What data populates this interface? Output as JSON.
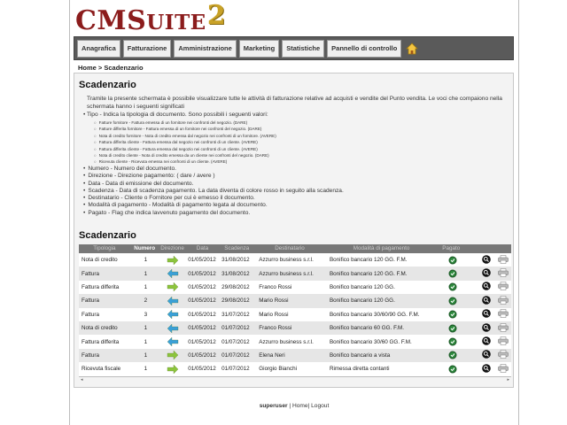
{
  "logo": {
    "text_big": "CMS",
    "text_small": "UITE",
    "superscript": "2"
  },
  "nav": [
    {
      "label": "Anagrafica"
    },
    {
      "label": "Fatturazione"
    },
    {
      "label": "Amministrazione"
    },
    {
      "label": "Marketing"
    },
    {
      "label": "Statistiche"
    },
    {
      "label": "Pannello di controllo"
    }
  ],
  "breadcrumb": "Home >  Scadenzario",
  "heading": "Scadenzario",
  "intro": "Tramite la presente schermata è possibile visualizzare tutte le attività di fatturazione relative ad acquisti e vendite del Punto vendita. Le voci che compaiono nella schermata hanno i seguenti significati",
  "tipo_item": "Tipo - Indica la tipologia di documento. Sono possibili i seguenti valori:",
  "tipo_values": [
    "Fatture fornitore - Fattura emessa di un fornitore nei confronti del negozio. (DARE)",
    "Fatture differita fornitore - Fattura emessa di un fornitore nei confronti del negozio. (DARE)",
    "Nota di credito fornitore - Nota di credito emessa dal negozio nei confronti di un fornitore. (AVERE)",
    "Fattura differita cliente - Fattura emessa dal negozio nei confronti di un cliente. (AVERE)",
    "Fattura differita cliente - Fattura emessa dal negozio nei confronti di un cliente. (AVERE)",
    "Nota di credito cliente - Nota di credito emessa da un cliente nei confronti del negozio. (DARE)",
    "Ricevuta cliente - Ricevuta emessa nei confronti di un cliente. (AVERE)"
  ],
  "list_items": [
    "Numero - Numero del documento.",
    "Direzione - Direzione pagamento: ( dare / avere )",
    "Data - Data di emissione del documento.",
    "Scadenza - Data di scadenza pagamento. La data diventa di colore rosso in seguito alla scadenza.",
    "Destinatario - Cliente o Fornitore per cui è emesso il documento.",
    "Modalità di pagamento - Modalità di pagamento legata al documento.",
    "Pagato - Flag che indica lavvenuto pagamento del documento."
  ],
  "table_heading": "Scadenzario",
  "columns": [
    "Tipologia",
    "Numero",
    "Direzione",
    "Data",
    "Scadenza",
    "Destinatario",
    "Modalità di pagamento",
    "Pagato"
  ],
  "rows": [
    {
      "tipo": "Nota di credito",
      "num": "1",
      "dir": "right",
      "data": "01/05/2012",
      "scad": "31/08/2012",
      "dest": "Azzurro business s.r.l.",
      "mod": "Bonifico bancario 120 GG. F.M."
    },
    {
      "tipo": "Fattura",
      "num": "1",
      "dir": "left",
      "data": "01/05/2012",
      "scad": "31/08/2012",
      "dest": "Azzurro business s.r.l.",
      "mod": "Bonifico bancario 120 GG. F.M."
    },
    {
      "tipo": "Fattura differita",
      "num": "1",
      "dir": "right",
      "data": "01/05/2012",
      "scad": "29/08/2012",
      "dest": "Franco Rossi",
      "mod": "Bonifico bancario 120 GG."
    },
    {
      "tipo": "Fattura",
      "num": "2",
      "dir": "left",
      "data": "01/05/2012",
      "scad": "29/08/2012",
      "dest": "Mario Rossi",
      "mod": "Bonifico bancario 120 GG."
    },
    {
      "tipo": "Fattura",
      "num": "3",
      "dir": "left",
      "data": "01/05/2012",
      "scad": "31/07/2012",
      "dest": "Mario Rossi",
      "mod": "Bonifico bancario 30/60/90 GG. F.M."
    },
    {
      "tipo": "Nota di credito",
      "num": "1",
      "dir": "left",
      "data": "01/05/2012",
      "scad": "01/07/2012",
      "dest": "Franco Rossi",
      "mod": "Bonifico bancario 60 GG. F.M."
    },
    {
      "tipo": "Fattura differita",
      "num": "1",
      "dir": "left",
      "data": "01/05/2012",
      "scad": "01/07/2012",
      "dest": "Azzurro business s.r.l.",
      "mod": "Bonifico bancario 30/60 GG. F.M."
    },
    {
      "tipo": "Fattura",
      "num": "1",
      "dir": "right",
      "data": "01/05/2012",
      "scad": "01/07/2012",
      "dest": "Elena Neri",
      "mod": "Bonifico bancario a vista"
    },
    {
      "tipo": "Ricevuta fiscale",
      "num": "1",
      "dir": "right",
      "data": "01/05/2012",
      "scad": "01/07/2012",
      "dest": "Giorgio Bianchi",
      "mod": "Rimessa diretta contanti"
    }
  ],
  "footer": {
    "user": "superuser",
    "home": "Home",
    "logout": "Logout"
  },
  "colors": {
    "logo_red": "#8b1c1c",
    "logo_gold": "#c9a227",
    "nav_bg": "#5a5a5a",
    "arrow_right": "#8cc43c",
    "arrow_left": "#3aa0d8",
    "paid_green": "#2e8b3e"
  }
}
